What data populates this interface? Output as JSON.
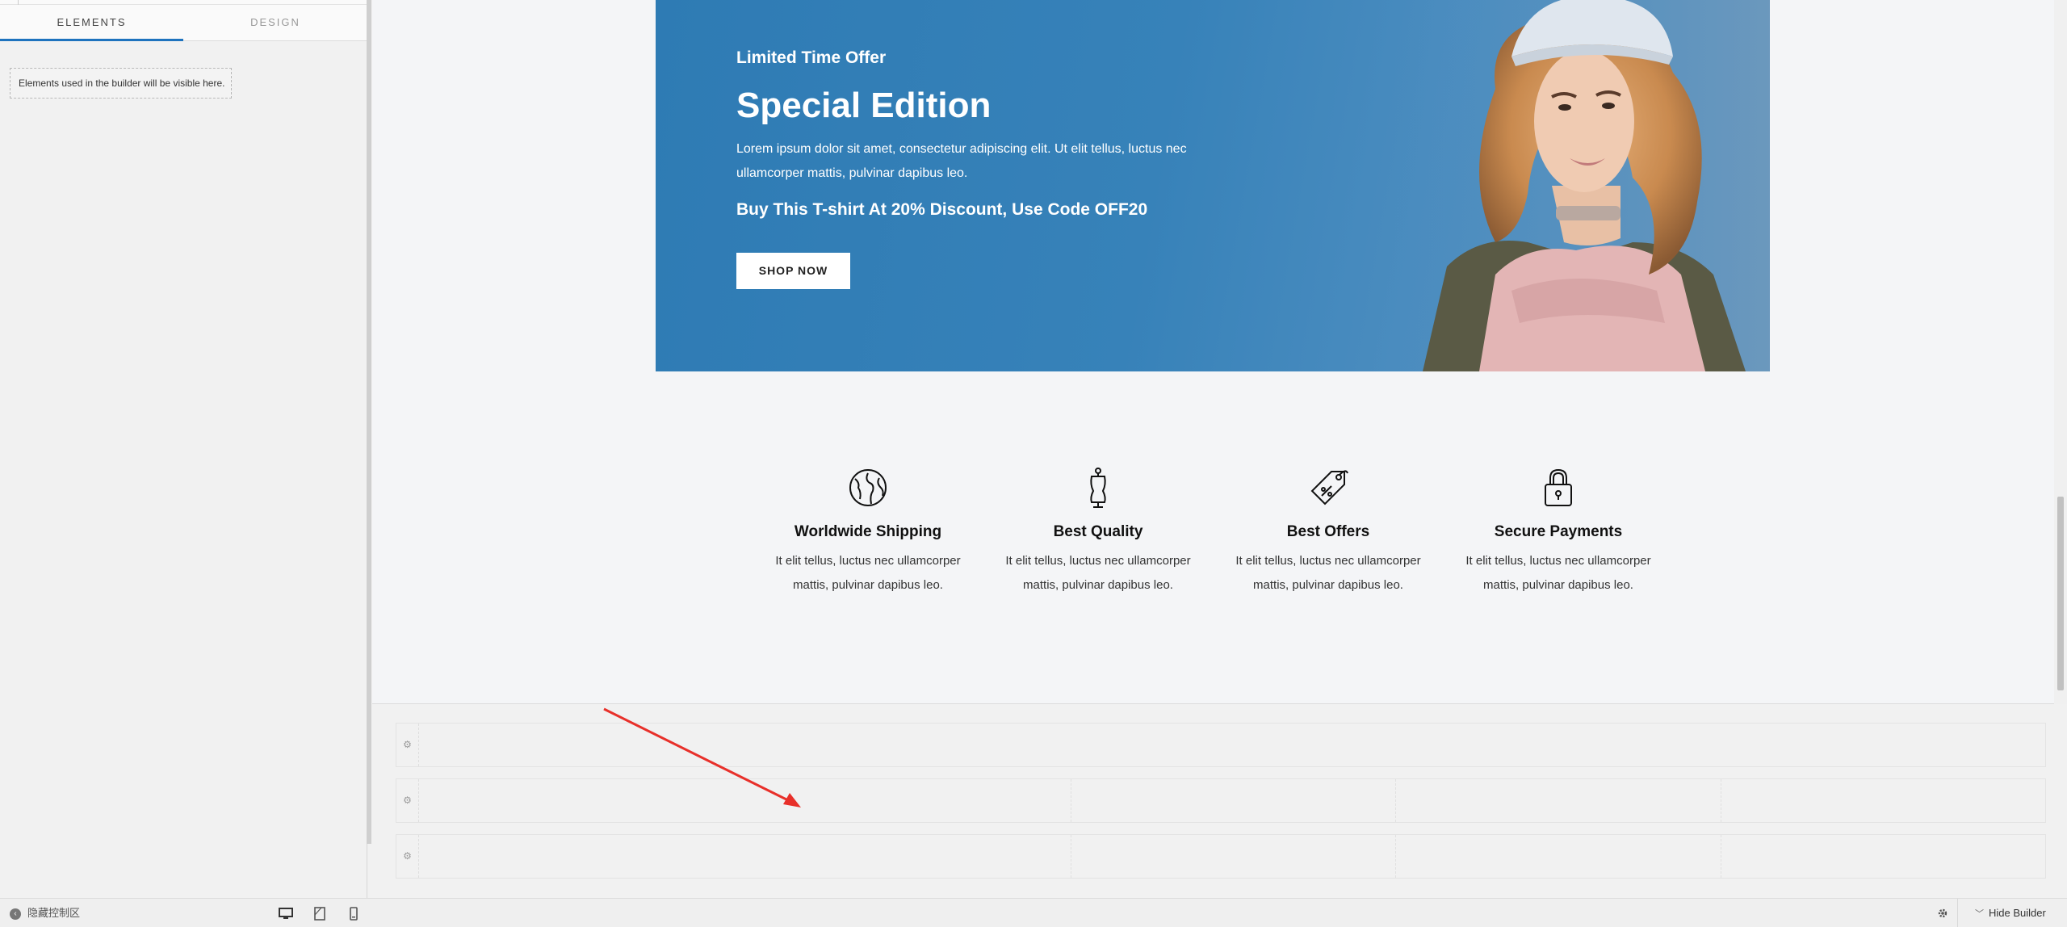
{
  "builder": {
    "tabs": [
      {
        "label": "ELEMENTS",
        "active": true
      },
      {
        "label": "DESIGN",
        "active": false
      }
    ],
    "elements_hint": "Elements used in the builder will be visible here.",
    "bottom_bar": {
      "hide_panel_label": "隐藏控制区",
      "hide_builder_label": "Hide Builder",
      "device_icons": [
        "desktop-icon",
        "tablet-icon",
        "mobile-icon"
      ],
      "settings_icon": "gear-icon"
    }
  },
  "hero": {
    "eyebrow": "Limited Time Offer",
    "title": "Special Edition",
    "text": "Lorem ipsum dolor sit amet, consectetur adipiscing elit. Ut elit tellus, luctus nec ullamcorper mattis, pulvinar dapibus leo.",
    "discount": "Buy This T-shirt At 20% Discount, Use Code OFF20",
    "button_label": "SHOP NOW",
    "background_color": "#2e7bb4"
  },
  "features": [
    {
      "icon": "globe-icon",
      "title": "Worldwide Shipping",
      "text": "It elit tellus, luctus nec ullamcorper mattis, pulvinar dapibus leo."
    },
    {
      "icon": "mannequin-icon",
      "title": "Best Quality",
      "text": "It elit tellus, luctus nec ullamcorper mattis, pulvinar dapibus leo."
    },
    {
      "icon": "price-tag-icon",
      "title": "Best Offers",
      "text": "It elit tellus, luctus nec ullamcorper mattis, pulvinar dapibus leo."
    },
    {
      "icon": "padlock-icon",
      "title": "Secure Payments",
      "text": "It elit tellus, luctus nec ullamcorper mattis, pulvinar dapibus leo."
    }
  ],
  "builder_rows": [
    {
      "columns": 1
    },
    {
      "columns": 4
    },
    {
      "columns": 4
    }
  ],
  "annotation": {
    "type": "red-arrow",
    "color": "#e8302a"
  }
}
